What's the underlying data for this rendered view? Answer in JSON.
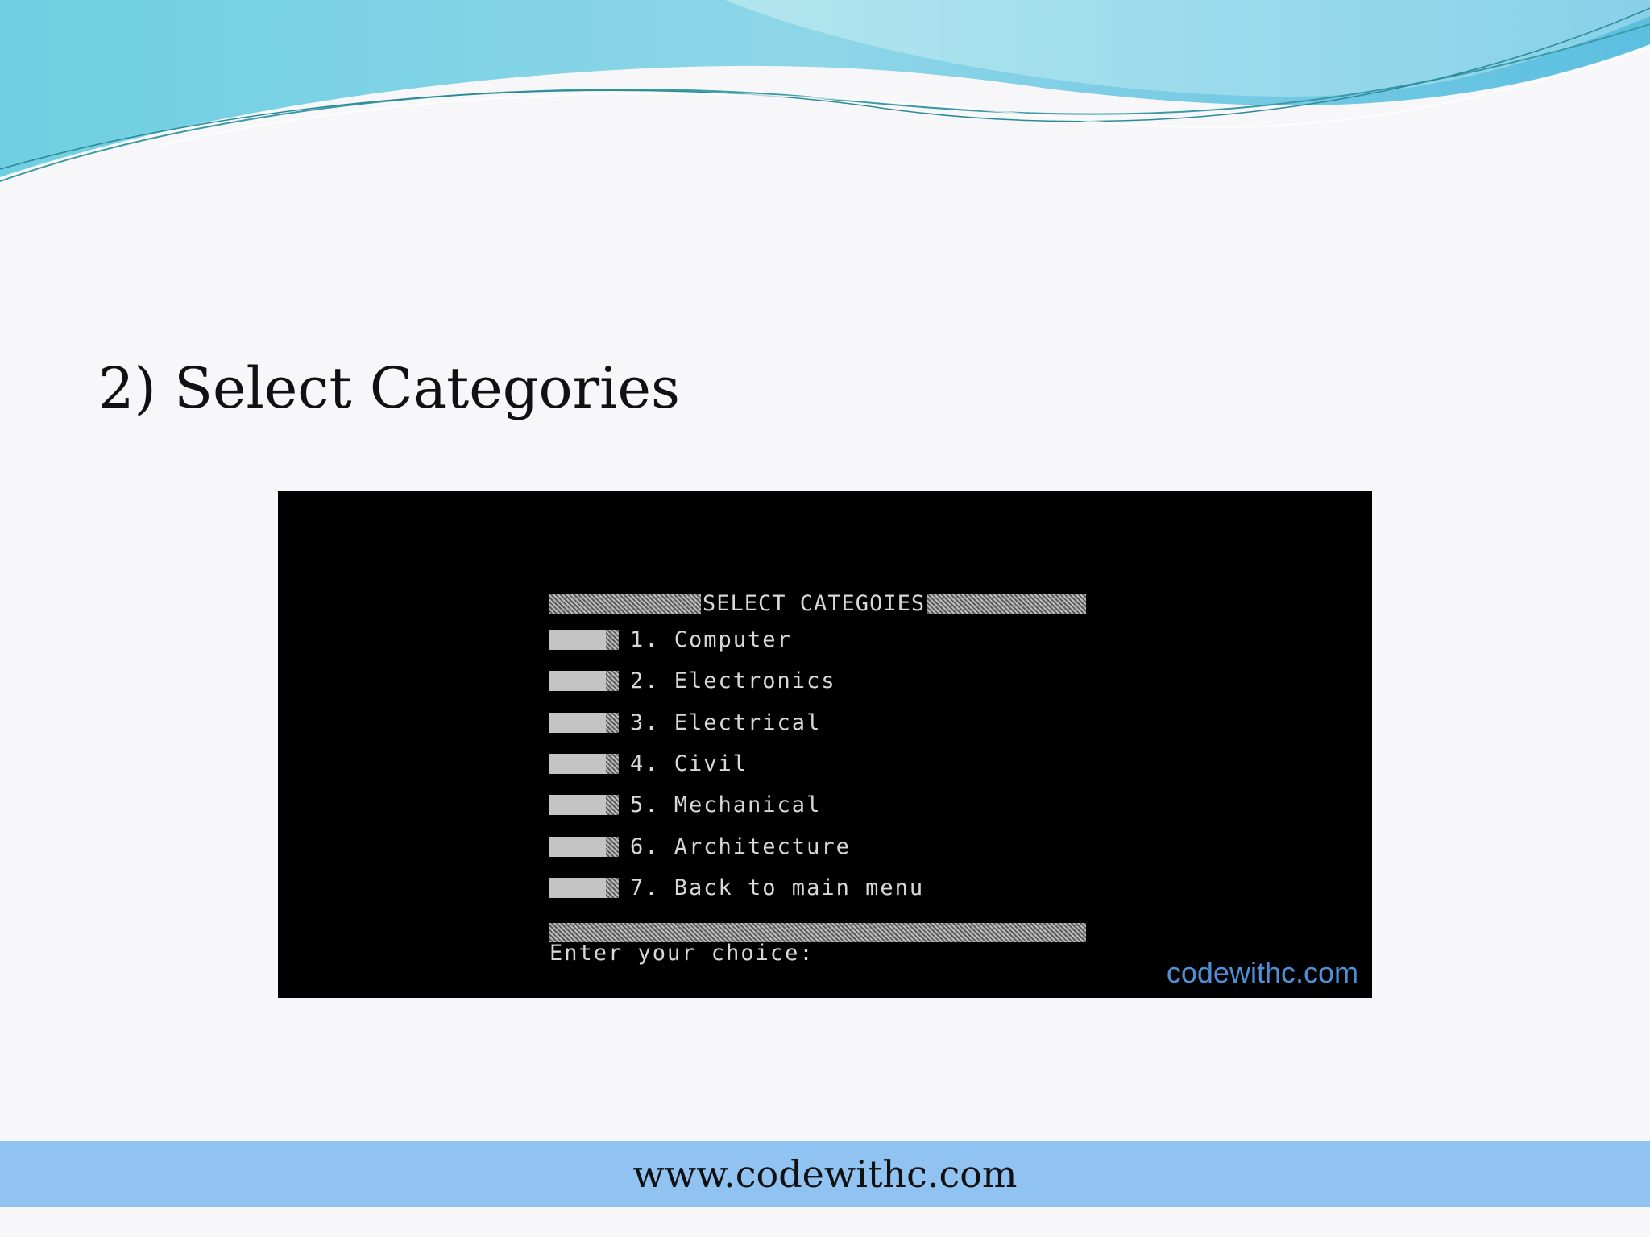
{
  "slide": {
    "title": "2) Select Categories"
  },
  "console": {
    "header": "SELECT CATEGOIES",
    "items": [
      {
        "label": "1. Computer"
      },
      {
        "label": "2. Electronics"
      },
      {
        "label": "3. Electrical"
      },
      {
        "label": "4. Civil"
      },
      {
        "label": "5. Mechanical"
      },
      {
        "label": "6. Architecture"
      },
      {
        "label": "7. Back to main menu"
      }
    ],
    "prompt": "Enter your choice:",
    "watermark": "codewithc.com"
  },
  "footer": {
    "url": "www.codewithc.com"
  },
  "colors": {
    "console_background": "#000000",
    "console_text": "#d8d8d8",
    "footer_background": "#90c2f2",
    "watermark": "#4f8fd6",
    "wave_primary": "#7fd3e3"
  }
}
